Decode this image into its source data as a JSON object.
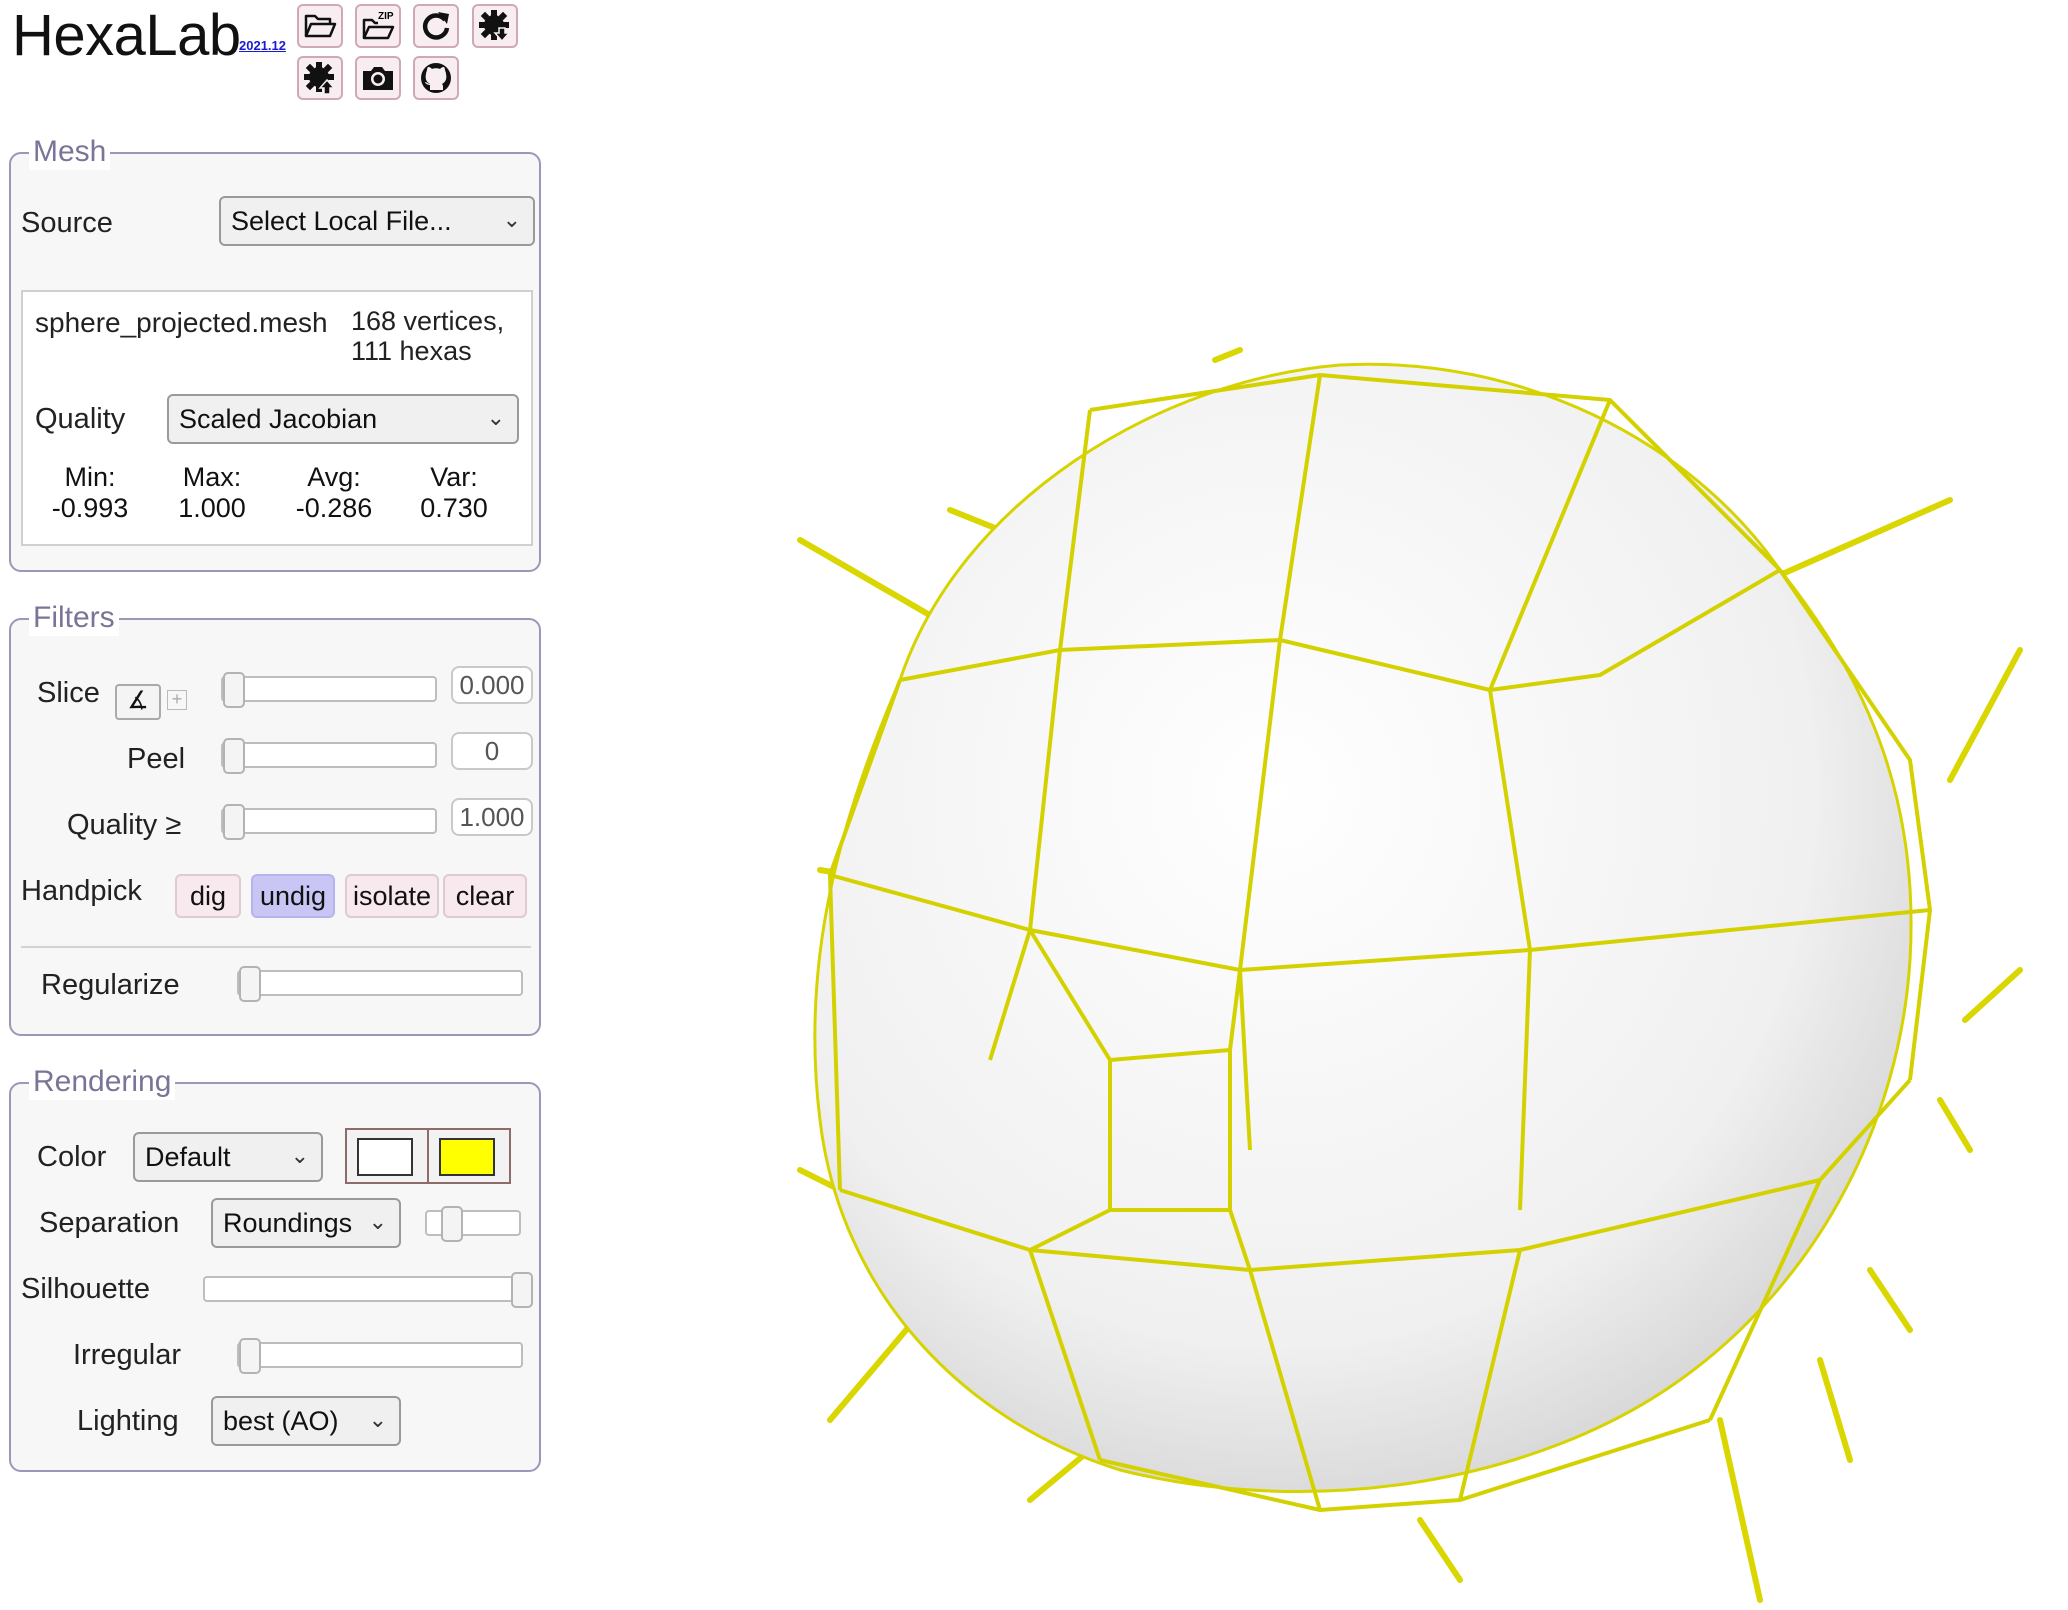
{
  "app": {
    "title": "HexaLab",
    "version": "2021.12"
  },
  "toolbar": {
    "buttons": [
      {
        "icon": "folder-open-icon"
      },
      {
        "icon": "zip-folder-icon",
        "text": "ZIP"
      },
      {
        "icon": "reload-icon"
      },
      {
        "icon": "settings-download-icon"
      },
      {
        "icon": "settings-upload-icon"
      },
      {
        "icon": "camera-icon"
      },
      {
        "icon": "github-icon"
      }
    ]
  },
  "mesh": {
    "legend": "Mesh",
    "source_label": "Source",
    "source_value": "Select Local File...",
    "filename": "sphere_projected.mesh",
    "vertices": "168 vertices,",
    "hexas": "111 hexas",
    "quality_label": "Quality",
    "quality_value": "Scaled Jacobian",
    "stats": [
      {
        "label": "Min:",
        "value": "-0.993"
      },
      {
        "label": "Max:",
        "value": "1.000"
      },
      {
        "label": "Avg:",
        "value": "-0.286"
      },
      {
        "label": "Var:",
        "value": "0.730"
      }
    ]
  },
  "filters": {
    "legend": "Filters",
    "slice_label": "Slice",
    "slice_value": "0.000",
    "peel_label": "Peel",
    "peel_value": "0",
    "quality_label": "Quality ≥",
    "quality_value": "1.000",
    "handpick_label": "Handpick",
    "handpick_buttons": [
      "dig",
      "undig",
      "isolate",
      "clear"
    ],
    "regularize_label": "Regularize"
  },
  "rendering": {
    "legend": "Rendering",
    "color_label": "Color",
    "color_value": "Default",
    "surface_color": "#ffffff",
    "edge_color": "#ffff00",
    "separation_label": "Separation",
    "separation_value": "Roundings",
    "silhouette_label": "Silhouette",
    "irregular_label": "Irregular",
    "lighting_label": "Lighting",
    "lighting_value": "best (AO)"
  }
}
